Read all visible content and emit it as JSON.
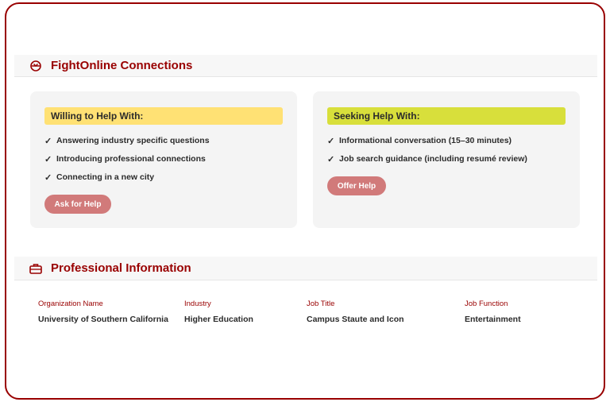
{
  "connections": {
    "title": "FightOnline Connections",
    "icon": "handshake-icon",
    "willing": {
      "heading": "Willing to Help With:",
      "items": [
        "Answering industry specific questions",
        "Introducing professional connections",
        "Connecting in a new city"
      ],
      "button": "Ask for Help"
    },
    "seeking": {
      "heading": "Seeking Help With:",
      "items": [
        "Informational conversation (15–30 minutes)",
        "Job search guidance (including resumé review)"
      ],
      "button": "Offer Help"
    },
    "check_glyph": "✓"
  },
  "professional": {
    "title": "Professional Information",
    "icon": "briefcase-icon",
    "fields": [
      {
        "label": "Organization Name",
        "value": "University of Southern California"
      },
      {
        "label": "Industry",
        "value": "Higher Education"
      },
      {
        "label": "Job Title",
        "value": "Campus Staute and Icon"
      },
      {
        "label": "Job Function",
        "value": "Entertainment"
      }
    ]
  },
  "colors": {
    "accent": "#990000",
    "willing_bar": "#ffe174",
    "seeking_bar": "#d8df3b",
    "button": "#d17a7a"
  }
}
